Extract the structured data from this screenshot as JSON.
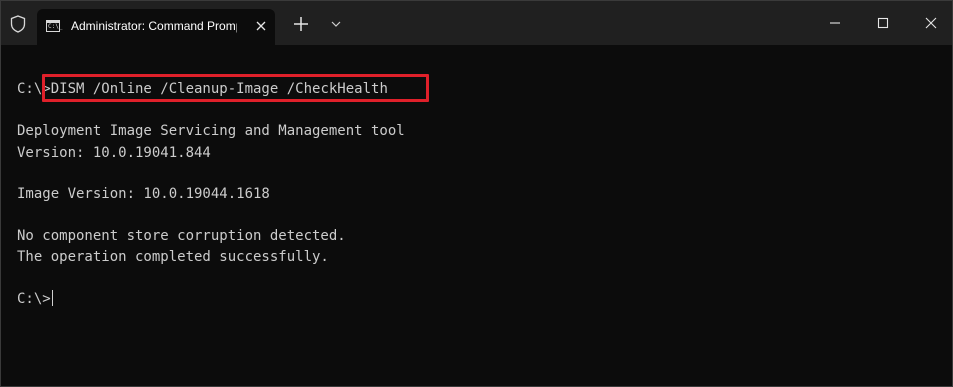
{
  "window": {
    "tab_title": "Administrator: Command Prompt",
    "tab_icon_prompt": "C:\\_",
    "buttons": {
      "new_tab": "+",
      "dropdown": "chevron-down-icon",
      "minimize": "minimize-icon",
      "maximize": "maximize-icon",
      "close": "close-icon"
    }
  },
  "terminal": {
    "command_prompt": "C:\\>",
    "command": "DISM /Online /Cleanup-Image /CheckHealth",
    "output_tool": "Deployment Image Servicing and Management tool",
    "output_version": "Version: 10.0.19041.844",
    "output_image_version": "Image Version: 10.0.19044.1618",
    "output_no_corruption": "No component store corruption detected.",
    "output_completed": "The operation completed successfully.",
    "final_prompt": "C:\\>"
  },
  "colors": {
    "titlebar": "#202020",
    "background": "#0c0c0c",
    "text": "#cccccc",
    "highlight": "#e0202a"
  }
}
